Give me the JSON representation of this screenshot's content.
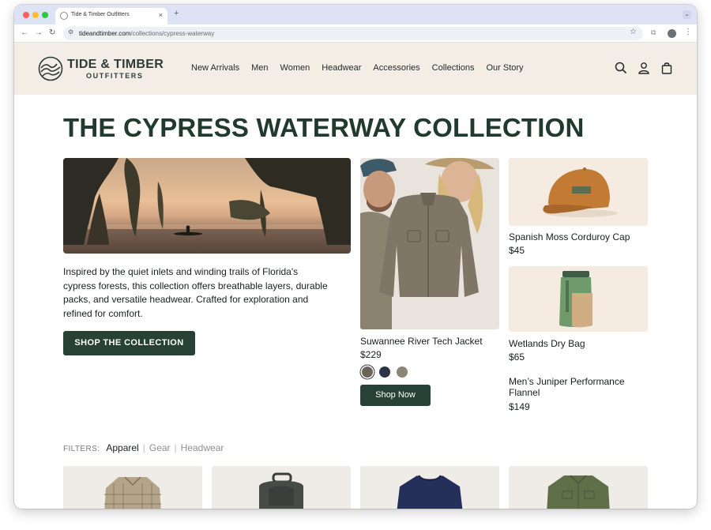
{
  "browser": {
    "tab_title": "Tide & Timber Outfitters",
    "url_host": "tideandtimber.com",
    "url_path": "/collections/cypress-waterway"
  },
  "brand": {
    "name": "TIDE & TIMBER",
    "subtitle": "OUTFITTERS"
  },
  "nav": {
    "items": [
      "New Arrivals",
      "Men",
      "Women",
      "Headwear",
      "Accessories",
      "Collections",
      "Our Story"
    ]
  },
  "collection": {
    "title": "THE CYPRESS WATERWAY COLLECTION",
    "description": "Inspired by the quiet inlets and winding trails of Florida's cypress forests, this collection offers breathable layers, durable packs, and versatile headwear. Crafted for exploration and refined for comfort.",
    "cta": "SHOP THE COLLECTION"
  },
  "featured": {
    "name": "Suwannee River Tech Jacket",
    "price": "$229",
    "cta": "Shop Now",
    "swatches": [
      "#6b6558",
      "#2c3547",
      "#8c8676"
    ]
  },
  "side_products": [
    {
      "name": "Spanish Moss Corduroy Cap",
      "price": "$45"
    },
    {
      "name": "Wetlands Dry Bag",
      "price": "$65"
    },
    {
      "name": "Men’s Juniper Performance Flannel",
      "price": "$149"
    }
  ],
  "filters": {
    "label": "FILTERS:",
    "options": [
      "Apparel",
      "Gear",
      "Headwear"
    ],
    "active": "Apparel"
  },
  "colors": {
    "primary": "#274137",
    "header_bg": "#f4ede5",
    "title": "#213a2f"
  },
  "icons": [
    "search-icon",
    "account-icon",
    "bag-icon",
    "star-icon",
    "back-icon",
    "forward-icon",
    "reload-icon"
  ]
}
